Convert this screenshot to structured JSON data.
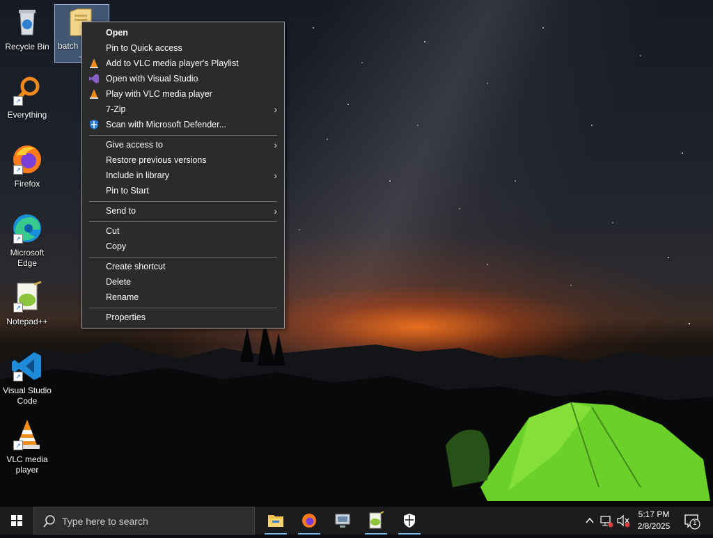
{
  "desktop": {
    "icons": [
      {
        "label": "Recycle Bin",
        "icon": "recycle-bin-icon"
      },
      {
        "label": "Everything",
        "icon": "everything-search-icon"
      },
      {
        "label": "Firefox",
        "icon": "firefox-icon"
      },
      {
        "label": "Microsoft Edge",
        "icon": "edge-icon"
      },
      {
        "label": "Notepad++",
        "icon": "notepad-plus-plus-icon"
      },
      {
        "label": "Visual Studio Code",
        "icon": "vscode-icon"
      },
      {
        "label": "VLC media player",
        "icon": "vlc-icon"
      }
    ],
    "selected_item": {
      "label": "batch",
      "label_tail": "-",
      "icon": "batch-file-icon"
    }
  },
  "context_menu": {
    "items": [
      {
        "label": "Open",
        "bold": true
      },
      {
        "label": "Pin to Quick access"
      },
      {
        "label": "Add to VLC media player's Playlist",
        "icon": "vlc-cone-icon"
      },
      {
        "label": "Open with Visual Studio",
        "icon": "visual-studio-icon"
      },
      {
        "label": "Play with VLC media player",
        "icon": "vlc-cone-icon"
      },
      {
        "label": "7-Zip",
        "submenu": true
      },
      {
        "label": "Scan with Microsoft Defender...",
        "icon": "defender-shield-icon"
      },
      {
        "label": "Give access to",
        "submenu": true
      },
      {
        "label": "Restore previous versions"
      },
      {
        "label": "Include in library",
        "submenu": true
      },
      {
        "label": "Pin to Start"
      },
      {
        "label": "Send to",
        "submenu": true
      },
      {
        "label": "Cut"
      },
      {
        "label": "Copy"
      },
      {
        "label": "Create shortcut"
      },
      {
        "label": "Delete"
      },
      {
        "label": "Rename"
      },
      {
        "label": "Properties"
      }
    ]
  },
  "taskbar": {
    "search_placeholder": "Type here to search",
    "pinned": [
      "file-explorer-icon",
      "firefox-icon",
      "network-app-icon",
      "notepad-plus-plus-icon",
      "security-shield-icon"
    ],
    "clock": {
      "time": "5:17 PM",
      "date": "2/8/2025"
    },
    "notification_count": "1"
  },
  "colors": {
    "menu_bg": "#2b2b2b",
    "taskbar_bg": "#1c1c1c",
    "accent": "#76b9ed"
  }
}
